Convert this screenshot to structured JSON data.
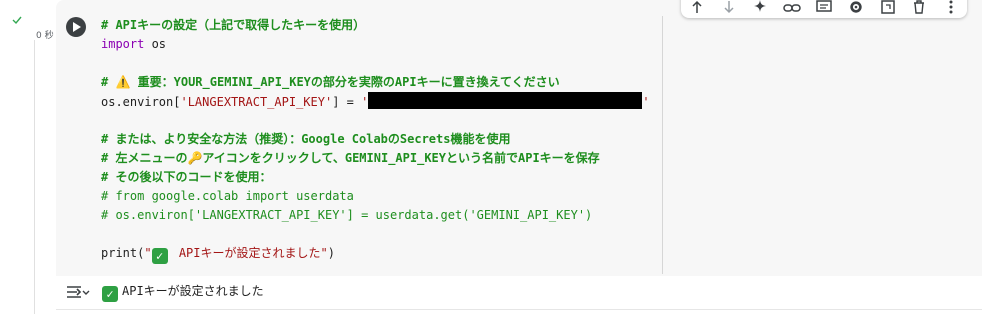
{
  "gutter": {
    "status_icon": "check-icon",
    "exec_time": "0 秒"
  },
  "toolbar": {
    "buttons": [
      {
        "icon": "arrow-up-icon",
        "label": "Move cell up"
      },
      {
        "icon": "arrow-down-icon",
        "label": "Move cell down"
      },
      {
        "icon": "sparkle-icon",
        "label": "Gemini"
      },
      {
        "icon": "link-icon",
        "label": "Copy link to cell"
      },
      {
        "icon": "comment-icon",
        "label": "Add comment"
      },
      {
        "icon": "gear-icon",
        "label": "Open editor settings"
      },
      {
        "icon": "mirror-cell-icon",
        "label": "Mirror cell in tab"
      },
      {
        "icon": "trash-icon",
        "label": "Delete cell"
      },
      {
        "icon": "more-vert-icon",
        "label": "More cell actions"
      }
    ]
  },
  "code": {
    "l1": "# APIキーの設定（上記で取得したキーを使用）",
    "l2_kw": "import",
    "l2_rest": " os",
    "l4_pre": "# ",
    "l4_emoji": "⚠️",
    "l4_text": " 重要：YOUR_GEMINI_API_KEYの部分を実際のAPIキーに置き換えてください",
    "l5_a": "os.environ[",
    "l5_key": "'LANGEXTRACT_API_KEY'",
    "l5_b": "] = ",
    "l5_q1": "'",
    "l5_q2": "'",
    "l7": "# または、より安全な方法（推奨）：Google ColabのSecrets機能を使用",
    "l8_pre": "# 左メニューの",
    "l8_emoji": "🔑",
    "l8_text": "アイコンをクリックして、GEMINI_API_KEYという名前でAPIキーを保存",
    "l9": "# その後以下のコードを使用：",
    "l10": "# from google.colab import userdata",
    "l11": "# os.environ['LANGEXTRACT_API_KEY'] = userdata.get('GEMINI_API_KEY')",
    "l13_fn": "print(",
    "l13_q": "\"",
    "l13_emoji": "✅",
    "l13_str": " APIキーが設定されました",
    "l13_q2": "\"",
    "l13_end": ")"
  },
  "output": {
    "toggle_icon": "output-toggle-icon",
    "check": "✓",
    "text": "APIキーが設定されました"
  }
}
